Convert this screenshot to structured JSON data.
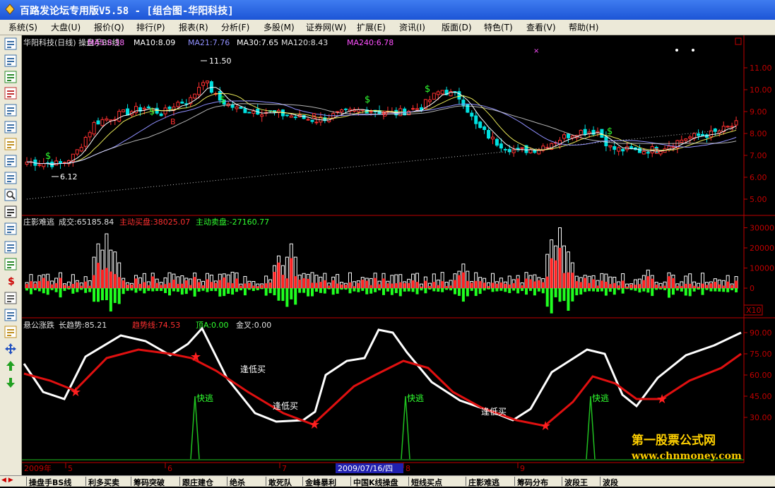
{
  "window": {
    "title": "百路发论坛专用版V5.58 - [组合图-华阳科技]"
  },
  "menu": [
    "系统(S)",
    "大盘(U)",
    "报价(Q)",
    "排行(P)",
    "报表(R)",
    "分析(F)",
    "多股(M)",
    "证券网(W)",
    "扩展(E)",
    "资讯(I)",
    "版面(D)",
    "特色(T)",
    "查看(V)",
    "帮助(H)"
  ],
  "colors": {
    "up": "#ff3030",
    "down": "#00e0e0",
    "green": "#30ff30",
    "axis": "#c00000",
    "ma5": "#ffffff",
    "ma10": "#ffff00",
    "ma21": "#9090ff",
    "ma30": "#ffffff",
    "ma120": "#d0d0d0",
    "ma240": "#ff50ff"
  },
  "price_panel": {
    "title": "华阳科技(日线) 操盘手BS线",
    "ma": [
      {
        "text": "MA5:8.38",
        "color": "#ff70ff"
      },
      {
        "text": "MA10:8.09",
        "color": "#ffffff"
      },
      {
        "text": "MA21:7.76",
        "color": "#9090ff"
      },
      {
        "text": "MA30:7.65",
        "color": "#ffffff"
      },
      {
        "text": "MA120:8.43",
        "color": "#e0e0e0"
      },
      {
        "text": "MA240:6.78",
        "color": "#ff50ff"
      }
    ],
    "high_label": "11.50",
    "low_label": "6.12",
    "y_ticks": [
      "11.00",
      "10.00",
      "9.00",
      "8.00",
      "7.00",
      "6.00",
      "5.00"
    ],
    "buy_marker": "$",
    "sell_marker": "B"
  },
  "volume_panel": {
    "title": "庄影难逃",
    "vol_label": "成交:65185.84",
    "buy_label": "主动买盘:38025.07",
    "sell_label": "主动卖盘:-27160.77",
    "y_ticks": [
      "30000",
      "20000",
      "10000",
      "0"
    ],
    "scale": "X10"
  },
  "trend_panel": {
    "title": "悬公涨跌",
    "long_label": "长趋势:85.21",
    "trend_label": "趋势线:74.53",
    "top_label": "顶A:0.00",
    "cross_label": "金叉:0.00",
    "y_ticks": [
      "90.00",
      "75.00",
      "60.00",
      "45.00",
      "30.00"
    ],
    "escape_text": "快逃",
    "lowbuy_text": "逢低买"
  },
  "date_axis": {
    "year": "2009年",
    "months": [
      "5",
      "6",
      "7",
      "8",
      "9"
    ],
    "cursor": "2009/07/16/四"
  },
  "tabs": [
    "操盘手BS线",
    "利多买卖",
    "筹码突破",
    "跟庄建仓",
    "绝杀",
    "敢死队",
    "金峰暴利",
    "中国K线操盘",
    "短线买点",
    "庄影难逃",
    "筹码分布",
    "波段王",
    "波段"
  ],
  "watermark": {
    "line1": "第一股票公式网",
    "line2": "www.chnmoney.com"
  }
}
